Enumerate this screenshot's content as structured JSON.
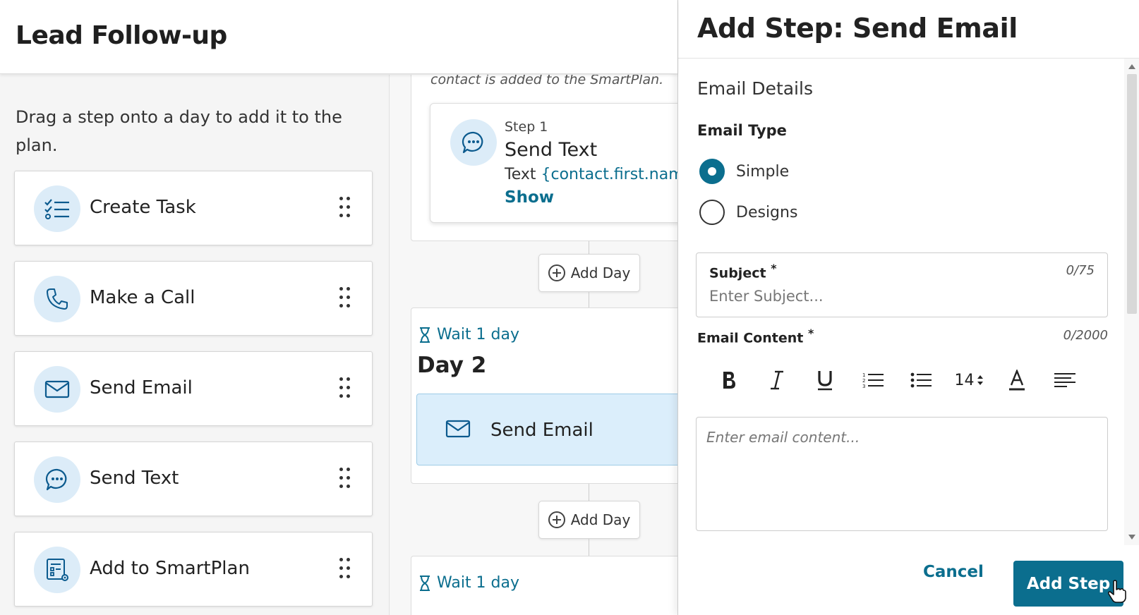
{
  "header": {
    "title": "Lead Follow-up"
  },
  "palette": {
    "hint": "Drag a step onto a day to add it to the plan.",
    "items": [
      {
        "label": "Create Task",
        "icon": "checklist-icon"
      },
      {
        "label": "Make a Call",
        "icon": "phone-icon"
      },
      {
        "label": "Send Email",
        "icon": "envelope-icon"
      },
      {
        "label": "Send Text",
        "icon": "chat-bubble-icon"
      },
      {
        "label": "Add to SmartPlan",
        "icon": "smartplan-icon"
      }
    ]
  },
  "canvas": {
    "note": "contact is added to the SmartPlan.",
    "step1": {
      "number": "Step 1",
      "title": "Send Text",
      "text_prefix": "Text",
      "text_token": "{contact.first.name",
      "show": "Show"
    },
    "add_day": "Add Day",
    "day2": {
      "wait": "Wait 1 day",
      "title": "Day 2",
      "step": "Send Email"
    },
    "day3": {
      "wait": "Wait 1 day"
    }
  },
  "drawer": {
    "title": "Add Step: Send Email",
    "section": "Email Details",
    "email_type_label": "Email Type",
    "email_types": [
      {
        "label": "Simple",
        "selected": true
      },
      {
        "label": "Designs",
        "selected": false
      }
    ],
    "subject": {
      "label": "Subject",
      "required": "*",
      "count": "0/75",
      "placeholder": "Enter Subject..."
    },
    "content": {
      "label": "Email Content",
      "required": "*",
      "count": "0/2000",
      "placeholder": "Enter email content..."
    },
    "toolbar": {
      "font_size": "14"
    },
    "cancel": "Cancel",
    "submit": "Add Step"
  },
  "colors": {
    "accent": "#0b6e8e",
    "icon_bg": "#dcecf8",
    "selected_step_bg": "#dbeefb"
  }
}
